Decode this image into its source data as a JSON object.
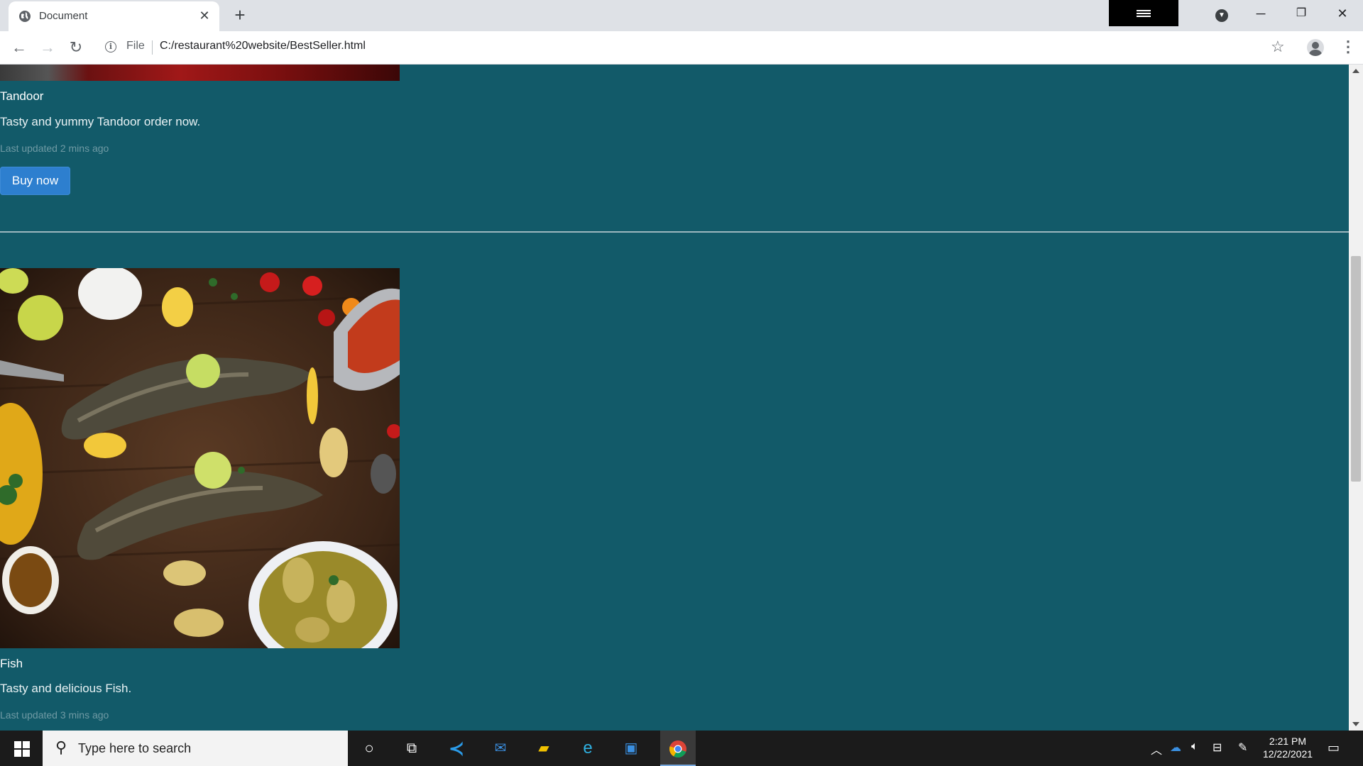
{
  "browser": {
    "tab_title": "Document",
    "address": {
      "scheme_label": "File",
      "url": "C:/restaurant%20website/BestSeller.html"
    }
  },
  "page": {
    "cards": [
      {
        "title": "Tandoor",
        "text": "Tasty and yummy Tandoor order now.",
        "updated": "Last updated 2 mins ago",
        "button": "Buy now"
      },
      {
        "title": "Fish",
        "text": "Tasty and delicious Fish.",
        "updated": "Last updated 3 mins ago"
      }
    ]
  },
  "taskbar": {
    "search_placeholder": "Type here to search",
    "time": "2:21 PM",
    "date": "12/22/2021"
  },
  "colors": {
    "page_background": "#125a69",
    "button": "#2d7fcf"
  }
}
